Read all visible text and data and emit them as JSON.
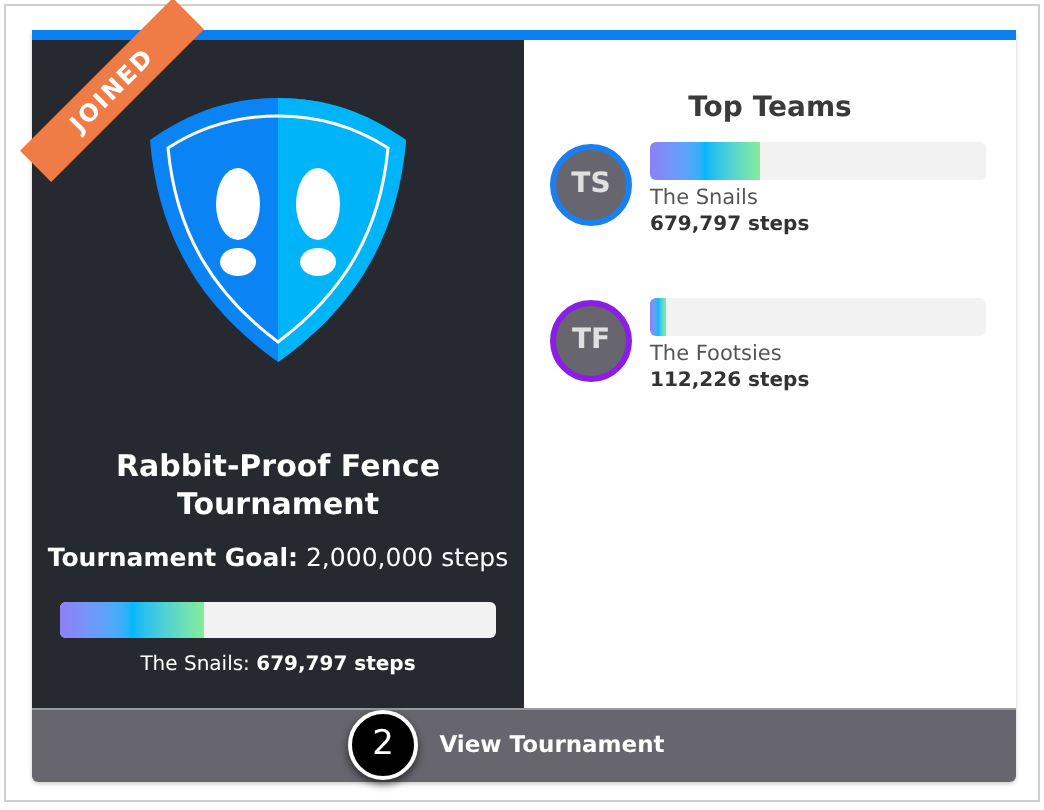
{
  "ribbon": "JOINED",
  "tournament": {
    "title": "Rabbit-Proof Fence Tournament",
    "goal_label": "Tournament Goal:",
    "goal_value": "2,000,000 steps",
    "leader_label": "The Snails:",
    "leader_steps": "679,797 steps",
    "level": 0.33
  },
  "top_teams": {
    "heading": "Top Teams",
    "teams": [
      {
        "initials": "TS",
        "name": "The Snails",
        "steps": "679,797 steps",
        "level": 0.33,
        "color": "#1a7ff0"
      },
      {
        "initials": "TF",
        "name": "The Footsies",
        "steps": "112,226 steps",
        "level": 0.05,
        "color": "#8a1ee6"
      }
    ]
  },
  "footer_button": "View Tournament",
  "callout": "2"
}
